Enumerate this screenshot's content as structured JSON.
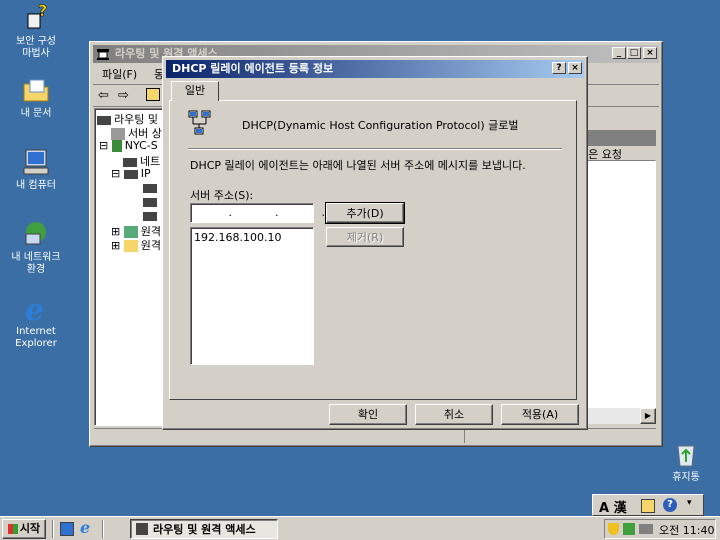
{
  "desktop": {
    "icons": [
      {
        "label_line1": "보안 구성",
        "label_line2": "마법사",
        "icon": "security-wizard-icon"
      },
      {
        "label_line1": "내 문서",
        "label_line2": "",
        "icon": "my-documents-icon"
      },
      {
        "label_line1": "내 컴퓨터",
        "label_line2": "",
        "icon": "my-computer-icon"
      },
      {
        "label_line1": "내 네트워크",
        "label_line2": "환경",
        "icon": "network-places-icon"
      },
      {
        "label_line1": "Internet",
        "label_line2": "Explorer",
        "icon": "internet-explorer-icon"
      }
    ],
    "recycle_bin": "휴지통"
  },
  "main_window": {
    "title": "라우팅 및 원격 액세스",
    "menu": [
      "파일(F)",
      "동"
    ],
    "tree": [
      "라우팅 및",
      "서버 상",
      "NYC-S",
      "네트",
      "IP",
      "원격",
      "원격"
    ],
    "right_header_fragment": "같은 요청"
  },
  "dialog": {
    "title": "DHCP 릴레이 에이전트 등록 정보",
    "help_btn": "?",
    "close_btn": "×",
    "tab": "일반",
    "protocol_name": "DHCP(Dynamic Host Configuration Protocol) 글로벌",
    "description": "DHCP 릴레이 에이전트는 아래에 나열된 서버 주소에 메시지를 보냅니다.",
    "server_address_label": "서버 주소(S):",
    "ip_placeholder": " .  .  .",
    "add_button": "추가(D)",
    "remove_button": "제거(R)",
    "servers": [
      "192.168.100.10"
    ],
    "ok_button": "확인",
    "cancel_button": "취소",
    "apply_button": "적용(A)"
  },
  "taskbar": {
    "start": "시작",
    "task": "라우팅 및 원격 액세스",
    "clock": "오전 11:40",
    "ime": "A 漢"
  }
}
